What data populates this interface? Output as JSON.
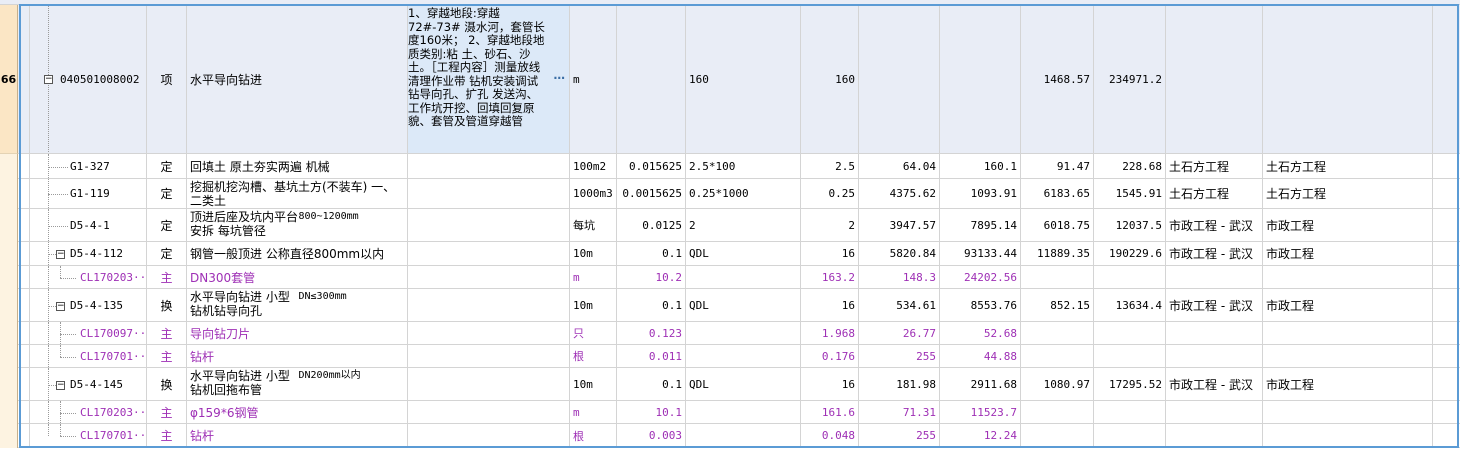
{
  "row_number": "66",
  "main_item": {
    "code": "040501008002",
    "type": "项",
    "name": "水平导向钻进",
    "description": "1、穿越地段:穿越 72#-73# 滠水河，套管长度160米； 2、穿越地段地质类别:粘 土、砂石、沙土。［工程内容］测量放线 清理作业带 钻机安装调试 钻导向孔、扩孔 发送沟、工作坑开挖、回填回复原貌、套管及管道穿越管",
    "desc_button": "…",
    "unit": "m",
    "quantity_expr": "160",
    "quantity": "160",
    "unit_price": "1468.57",
    "total": "234971.2"
  },
  "rows": [
    {
      "code": "G1-327",
      "type": "定",
      "name": "回填土 原土夯实两遍 机械",
      "unit": "100m2",
      "coef": "0.015625",
      "expr": "2.5*100",
      "qty": "2.5",
      "price": "64.04",
      "amount": "160.1",
      "uprice": "91.47",
      "total": "228.68",
      "cat": "土石方工程",
      "spec": "土石方工程",
      "level": 1,
      "sub": false
    },
    {
      "code": "G1-119",
      "type": "定",
      "name": "挖掘机挖沟槽、基坑土方(不装车) 一、二类土",
      "unit": "1000m3",
      "coef": "0.0015625",
      "expr": "0.25*1000",
      "qty": "0.25",
      "price": "4375.62",
      "amount": "1093.91",
      "uprice": "6183.65",
      "total": "1545.91",
      "cat": "土石方工程",
      "spec": "土石方工程",
      "level": 1,
      "sub": false
    },
    {
      "code": "D5-4-1",
      "type": "定",
      "name": "顶进后座及坑内平台安拆 每坑管径",
      "name2": "800~1200mm",
      "unit": "每坑",
      "coef": "0.0125",
      "expr": "2",
      "qty": "2",
      "price": "3947.57",
      "amount": "7895.14",
      "uprice": "6018.75",
      "total": "12037.5",
      "cat": "市政工程 - 武汉",
      "spec": "市政工程",
      "level": 1,
      "sub": false
    },
    {
      "code": "D5-4-112",
      "type": "定",
      "name": "钢管一般顶进 公称直径800mm以内",
      "unit": "10m",
      "coef": "0.1",
      "expr": "QDL",
      "qty": "16",
      "price": "5820.84",
      "amount": "93133.44",
      "uprice": "11889.35",
      "total": "190229.6",
      "cat": "市政工程 - 武汉",
      "spec": "市政工程",
      "level": 1,
      "sub": false,
      "expander": true
    },
    {
      "code": "CL170203···",
      "type": "主",
      "name": "DN300套管",
      "unit": "m",
      "coef": "10.2",
      "expr": "",
      "qty": "163.2",
      "price": "148.3",
      "amount": "24202.56",
      "uprice": "",
      "total": "",
      "cat": "",
      "spec": "",
      "level": 2,
      "sub": true
    },
    {
      "code": "D5-4-135",
      "type": "换",
      "name": "水平导向钻进 小型钻机钻导向孔",
      "name2": "DN≤300mm",
      "unit": "10m",
      "coef": "0.1",
      "expr": "QDL",
      "qty": "16",
      "price": "534.61",
      "amount": "8553.76",
      "uprice": "852.15",
      "total": "13634.4",
      "cat": "市政工程 - 武汉",
      "spec": "市政工程",
      "level": 1,
      "sub": false,
      "expander": true
    },
    {
      "code": "CL170097···",
      "type": "主",
      "name": "导向钻刀片",
      "unit": "只",
      "coef": "0.123",
      "expr": "",
      "qty": "1.968",
      "price": "26.77",
      "amount": "52.68",
      "uprice": "",
      "total": "",
      "cat": "",
      "spec": "",
      "level": 2,
      "sub": true
    },
    {
      "code": "CL170701···",
      "type": "主",
      "name": "钻杆",
      "unit": "根",
      "coef": "0.011",
      "expr": "",
      "qty": "0.176",
      "price": "255",
      "amount": "44.88",
      "uprice": "",
      "total": "",
      "cat": "",
      "spec": "",
      "level": 2,
      "sub": true
    },
    {
      "code": "D5-4-145",
      "type": "换",
      "name": "水平导向钻进 小型钻机回拖布管",
      "name2": "DN200mm以内",
      "unit": "10m",
      "coef": "0.1",
      "expr": "QDL",
      "qty": "16",
      "price": "181.98",
      "amount": "2911.68",
      "uprice": "1080.97",
      "total": "17295.52",
      "cat": "市政工程 - 武汉",
      "spec": "市政工程",
      "level": 1,
      "sub": false,
      "expander": true
    },
    {
      "code": "CL170203···",
      "type": "主",
      "name": "φ159*6钢管",
      "unit": "m",
      "coef": "10.1",
      "expr": "",
      "qty": "161.6",
      "price": "71.31",
      "amount": "11523.7",
      "uprice": "",
      "total": "",
      "cat": "",
      "spec": "",
      "level": 2,
      "sub": true
    },
    {
      "code": "CL170701···",
      "type": "主",
      "name": "钻杆",
      "unit": "根",
      "coef": "0.003",
      "expr": "",
      "qty": "0.048",
      "price": "255",
      "amount": "12.24",
      "uprice": "",
      "total": "",
      "cat": "",
      "spec": "",
      "level": 2,
      "sub": true
    }
  ],
  "colors": {
    "main_row_bg": "#e9edf6",
    "sub_text": "#9e2fb5",
    "selection": "#5b9bd5",
    "rownum_bg": "#fbe6c5"
  }
}
